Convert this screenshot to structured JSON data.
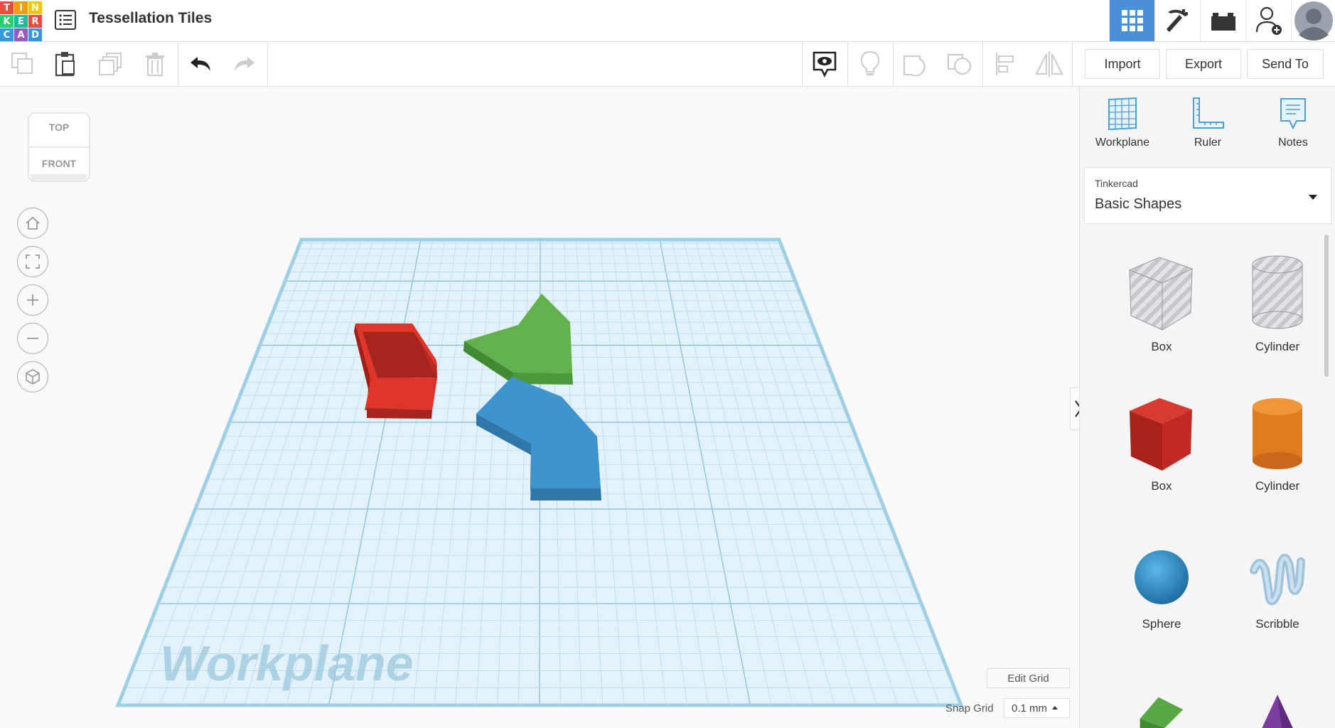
{
  "app": {
    "logo_letters": [
      "T",
      "I",
      "N",
      "K",
      "E",
      "R",
      "C",
      "A",
      "D"
    ],
    "logo_colors": [
      "#e74c3c",
      "#f39c12",
      "#f1c40f",
      "#2ecc71",
      "#1abc9c",
      "#e74c3c",
      "#3498db",
      "#9b59b6",
      "#3498db"
    ],
    "design_title": "Tessellation Tiles"
  },
  "topbar": {
    "icons": [
      "3d-design-grid-icon",
      "codeblocks-pickaxe-icon",
      "lego-brick-icon",
      "invite-user-icon",
      "avatar"
    ]
  },
  "toolbar": {
    "import_label": "Import",
    "export_label": "Export",
    "send_to_label": "Send To"
  },
  "viewcube": {
    "top_label": "TOP",
    "front_label": "FRONT"
  },
  "workplane": {
    "watermark": "Workplane",
    "edit_grid_label": "Edit Grid",
    "snap_grid_label": "Snap Grid",
    "snap_grid_value": "0.1 mm"
  },
  "panel": {
    "tools": [
      {
        "label": "Workplane",
        "icon": "workplane-icon"
      },
      {
        "label": "Ruler",
        "icon": "ruler-icon"
      },
      {
        "label": "Notes",
        "icon": "notes-icon"
      }
    ],
    "library_vendor": "Tinkercad",
    "library_name": "Basic Shapes",
    "shapes": [
      {
        "label": "Box",
        "style": "hole"
      },
      {
        "label": "Cylinder",
        "style": "hole"
      },
      {
        "label": "Box",
        "style": "solid"
      },
      {
        "label": "Cylinder",
        "style": "solid"
      },
      {
        "label": "Sphere",
        "style": "solid"
      },
      {
        "label": "Scribble",
        "style": "solid"
      }
    ]
  },
  "colors": {
    "accent": "#4a90d9",
    "grid": "#bfe0f0",
    "red_shape": "#e0352b",
    "green_shape": "#62b04e",
    "blue_shape": "#3e94cc"
  }
}
